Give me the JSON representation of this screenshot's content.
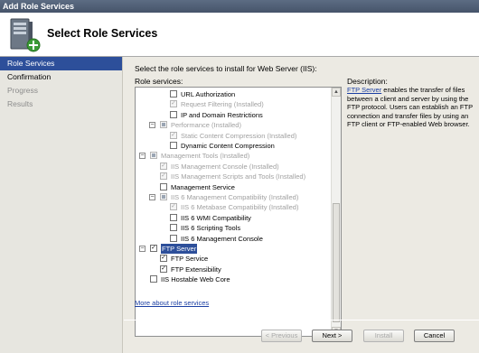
{
  "window": {
    "title": "Add Role Services"
  },
  "header": {
    "title": "Select Role Services",
    "icon": "server-add-icon"
  },
  "nav": [
    {
      "label": "Role Services",
      "state": "active"
    },
    {
      "label": "Confirmation",
      "state": "normal"
    },
    {
      "label": "Progress",
      "state": "disabled"
    },
    {
      "label": "Results",
      "state": "disabled"
    }
  ],
  "main": {
    "instruction": "Select the role services to install for Web Server (IIS):",
    "services_label": "Role services:",
    "more_link": "More about role services"
  },
  "tree": [
    {
      "label": "URL Authorization",
      "level": 2,
      "state": "unchecked",
      "disabled": false,
      "expander": ""
    },
    {
      "label": "Request Filtering  (Installed)",
      "level": 2,
      "state": "checked",
      "disabled": true,
      "expander": ""
    },
    {
      "label": "IP and Domain Restrictions",
      "level": 2,
      "state": "unchecked",
      "disabled": false,
      "expander": ""
    },
    {
      "label": "Performance  (Installed)",
      "level": 1,
      "state": "indeterminate",
      "disabled": true,
      "expander": "-"
    },
    {
      "label": "Static Content Compression  (Installed)",
      "level": 2,
      "state": "checked",
      "disabled": true,
      "expander": ""
    },
    {
      "label": "Dynamic Content Compression",
      "level": 2,
      "state": "unchecked",
      "disabled": false,
      "expander": ""
    },
    {
      "label": "Management Tools  (Installed)",
      "level": 0,
      "state": "indeterminate",
      "disabled": true,
      "expander": "-"
    },
    {
      "label": "IIS Management Console  (Installed)",
      "level": 1,
      "state": "checked",
      "disabled": true,
      "expander": ""
    },
    {
      "label": "IIS Management Scripts and Tools  (Installed)",
      "level": 1,
      "state": "checked",
      "disabled": true,
      "expander": ""
    },
    {
      "label": "Management Service",
      "level": 1,
      "state": "unchecked",
      "disabled": false,
      "expander": ""
    },
    {
      "label": "IIS 6 Management Compatibility  (Installed)",
      "level": 1,
      "state": "indeterminate",
      "disabled": true,
      "expander": "-"
    },
    {
      "label": "IIS 6 Metabase Compatibility  (Installed)",
      "level": 2,
      "state": "checked",
      "disabled": true,
      "expander": ""
    },
    {
      "label": "IIS 6 WMI Compatibility",
      "level": 2,
      "state": "unchecked",
      "disabled": false,
      "expander": ""
    },
    {
      "label": "IIS 6 Scripting Tools",
      "level": 2,
      "state": "unchecked",
      "disabled": false,
      "expander": ""
    },
    {
      "label": "IIS 6 Management Console",
      "level": 2,
      "state": "unchecked",
      "disabled": false,
      "expander": ""
    },
    {
      "label": "FTP Server",
      "level": 0,
      "state": "checked",
      "disabled": false,
      "expander": "-",
      "selected": true
    },
    {
      "label": "FTP Service",
      "level": 1,
      "state": "checked",
      "disabled": false,
      "expander": ""
    },
    {
      "label": "FTP Extensibility",
      "level": 1,
      "state": "checked",
      "disabled": false,
      "expander": ""
    },
    {
      "label": "IIS Hostable Web Core",
      "level": 0,
      "state": "unchecked",
      "disabled": false,
      "expander": ""
    }
  ],
  "description": {
    "title": "Description:",
    "link": "FTP Server",
    "text": " enables the transfer of files between a client and server by using the FTP protocol. Users can establish an FTP connection and transfer files by using an FTP client or FTP-enabled Web browser."
  },
  "buttons": {
    "previous": "< Previous",
    "next": "Next >",
    "install": "Install",
    "cancel": "Cancel"
  }
}
